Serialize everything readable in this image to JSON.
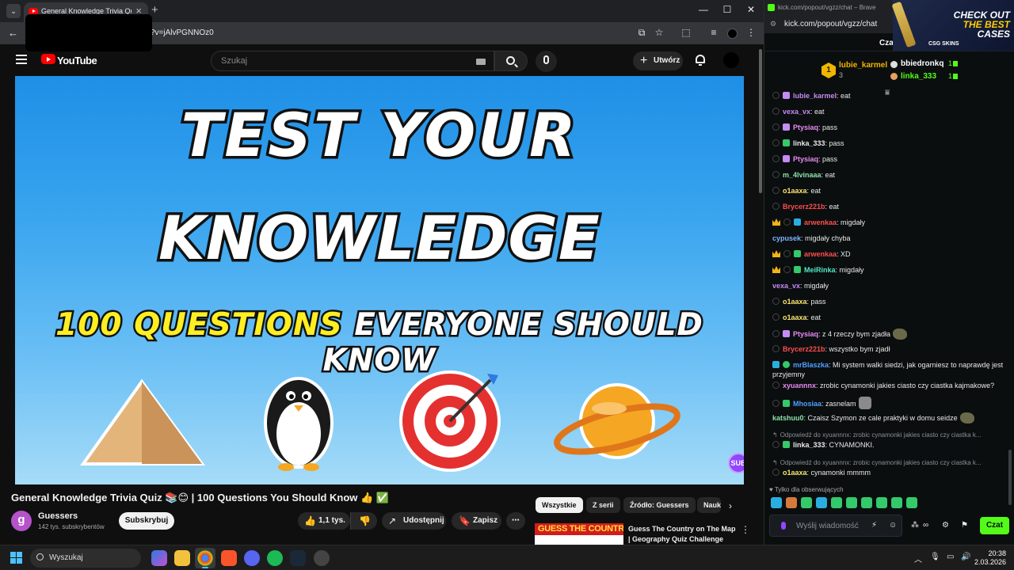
{
  "browser_left": {
    "tab_title": "General Knowledge Trivia Quiz",
    "url_fragment": "?v=jAlvPGNNOz0",
    "window_controls": [
      "—",
      "☐",
      "✕"
    ]
  },
  "youtube": {
    "logo_text": "YouTube",
    "search_placeholder": "Szukaj",
    "create_label": "Utwórz",
    "video_overlay": {
      "line1": "TEST YOUR",
      "line2": "KNOWLEDGE",
      "line3_highlight": "100 QUESTIONS",
      "line3_rest": " EVERYONE SHOULD KNOW",
      "sub_badge": "SUB"
    },
    "video_title": "General Knowledge Trivia Quiz 📚😊 | 100 Questions You Should Know 👍 ✅",
    "channel": {
      "avatar_letter": "g",
      "name": "Guessers",
      "subscribers": "142 tys. subskrybentów",
      "subscribe_label": "Subskrybuj"
    },
    "actions": {
      "likes": "1,1 tys.",
      "share": "Udostępnij",
      "save": "Zapisz",
      "more": "⋯"
    },
    "chips": [
      "Wszystkie",
      "Z serii",
      "Źródło: Guessers",
      "Nauk"
    ],
    "recommendation": {
      "thumb_text": "GUESS THE COUNTRY",
      "title": "Guess The Country on The Map | Geography Quiz Challenge"
    }
  },
  "kick": {
    "window_title": "kick.com/popout/vgzz/chat – Brave",
    "url": "kick.com/popout/vgzz/chat",
    "ad": {
      "line1": "CHECK OUT",
      "line2": "THE BEST",
      "line3": "CASES",
      "brand": "CSG SKINS"
    },
    "header_fragment": "Cza",
    "pinned": {
      "top_gifter": {
        "rank": "1",
        "name": "lubie_karmel",
        "count": "3"
      },
      "gifter2": {
        "name": "bbiedronkq",
        "count": "1"
      },
      "gifter3": {
        "name": "linka_333",
        "count": "1"
      }
    },
    "messages": [
      {
        "user": "lubie_karmel",
        "text": ": eat",
        "color": "#c48cf4",
        "badges": [
          "o",
          "p"
        ]
      },
      {
        "user": "vexa_vx",
        "text": ": eat",
        "color": "#c48cf4",
        "badges": [
          "o"
        ]
      },
      {
        "user": "Ptysiaq",
        "text": ": pass",
        "color": "#e889f2",
        "badges": [
          "o",
          "p"
        ]
      },
      {
        "user": "linka_333",
        "text": ": pass",
        "color": "#e8e8e8",
        "badges": [
          "o",
          "g"
        ]
      },
      {
        "user": "Ptysiaq",
        "text": ": pass",
        "color": "#e889f2",
        "badges": [
          "o",
          "p"
        ]
      },
      {
        "user": "m_4lvinaaa",
        "text": ": eat",
        "color": "#8be1a8",
        "badges": [
          "o"
        ]
      },
      {
        "user": "o1aaxa",
        "text": ": eat",
        "color": "#f8e46b",
        "badges": [
          "o"
        ]
      },
      {
        "user": "Brycerz221b",
        "text": ": eat",
        "color": "#ff4d4d",
        "badges": [
          "o"
        ]
      },
      {
        "user": "arwenkaa",
        "text": ": migdały",
        "color": "#ff4d4d",
        "badges": [
          "crown",
          "o",
          "t"
        ]
      },
      {
        "user": "cypusek",
        "text": ": migdały chyba",
        "color": "#7fb4ff",
        "badges": []
      },
      {
        "user": "arwenkaa",
        "text": ": XD",
        "color": "#ff4d4d",
        "badges": [
          "crown",
          "o",
          "g"
        ]
      },
      {
        "user": "MeiRinka",
        "text": ": migdały",
        "color": "#4ee8c6",
        "badges": [
          "crown",
          "o",
          "g"
        ]
      },
      {
        "user": "vexa_vx",
        "text": ": migdały",
        "color": "#c48cf4",
        "badges": []
      },
      {
        "user": "o1aaxa",
        "text": ": pass",
        "color": "#f8e46b",
        "badges": [
          "o"
        ]
      },
      {
        "user": "o1aaxa",
        "text": ": eat",
        "color": "#f8e46b",
        "badges": [
          "o"
        ]
      },
      {
        "user": "Ptysiaq",
        "text": ": z 4 rzeczy bym zjadła",
        "color": "#e889f2",
        "badges": [
          "o",
          "p"
        ],
        "emote": true
      },
      {
        "user": "Brycerz221b",
        "text": ": wszystko bym zjadł",
        "color": "#ff4d4d",
        "badges": [
          "o"
        ]
      },
      {
        "user": "mrBlaszka",
        "text": ": Mi system walki siedzi, jak ogarniesz to naprawdę jest przyjemny",
        "color": "#4ea0ff",
        "badges": [
          "t",
          "v"
        ],
        "wrap": true
      },
      {
        "user": "xyuannnx",
        "text": ": zrobic cynamonki jakies ciasto czy ciastka kajmakowe?",
        "color": "#e889f2",
        "badges": [
          "o"
        ]
      },
      {
        "user": "Mhosiaa",
        "text": ": zasnelam",
        "color": "#4ea0ff",
        "badges": [
          "o",
          "g"
        ],
        "emote2": true
      },
      {
        "user": "katshuu0",
        "text": ": Czaisz Szymon ze cale praktyki w domu seidze",
        "color": "#8be1a8",
        "badges": [],
        "emote": true
      },
      {
        "reply": "Odpowiedź do xyuannnx: zrobic cynamonki jakies ciasto czy ciastka k..."
      },
      {
        "user": "linka_333",
        "text": ": CYNAMONKI.",
        "color": "#e8e8e8",
        "badges": [
          "o",
          "g"
        ]
      },
      {
        "reply": "Odpowiedź do xyuannnx: zrobic cynamonki jakies ciasto czy ciastka k..."
      },
      {
        "user": "o1aaxa",
        "text": ": cynamonki mmmm",
        "color": "#f8e46b",
        "badges": [
          "o"
        ]
      }
    ],
    "followers_only": "Tylko dla obserwujących",
    "input_placeholder": "Wyślij wiadomość",
    "send_label": "Czat"
  },
  "taskbar": {
    "search_label": "Wyszukaj",
    "time": "20:38",
    "date": "2.03.2026"
  }
}
